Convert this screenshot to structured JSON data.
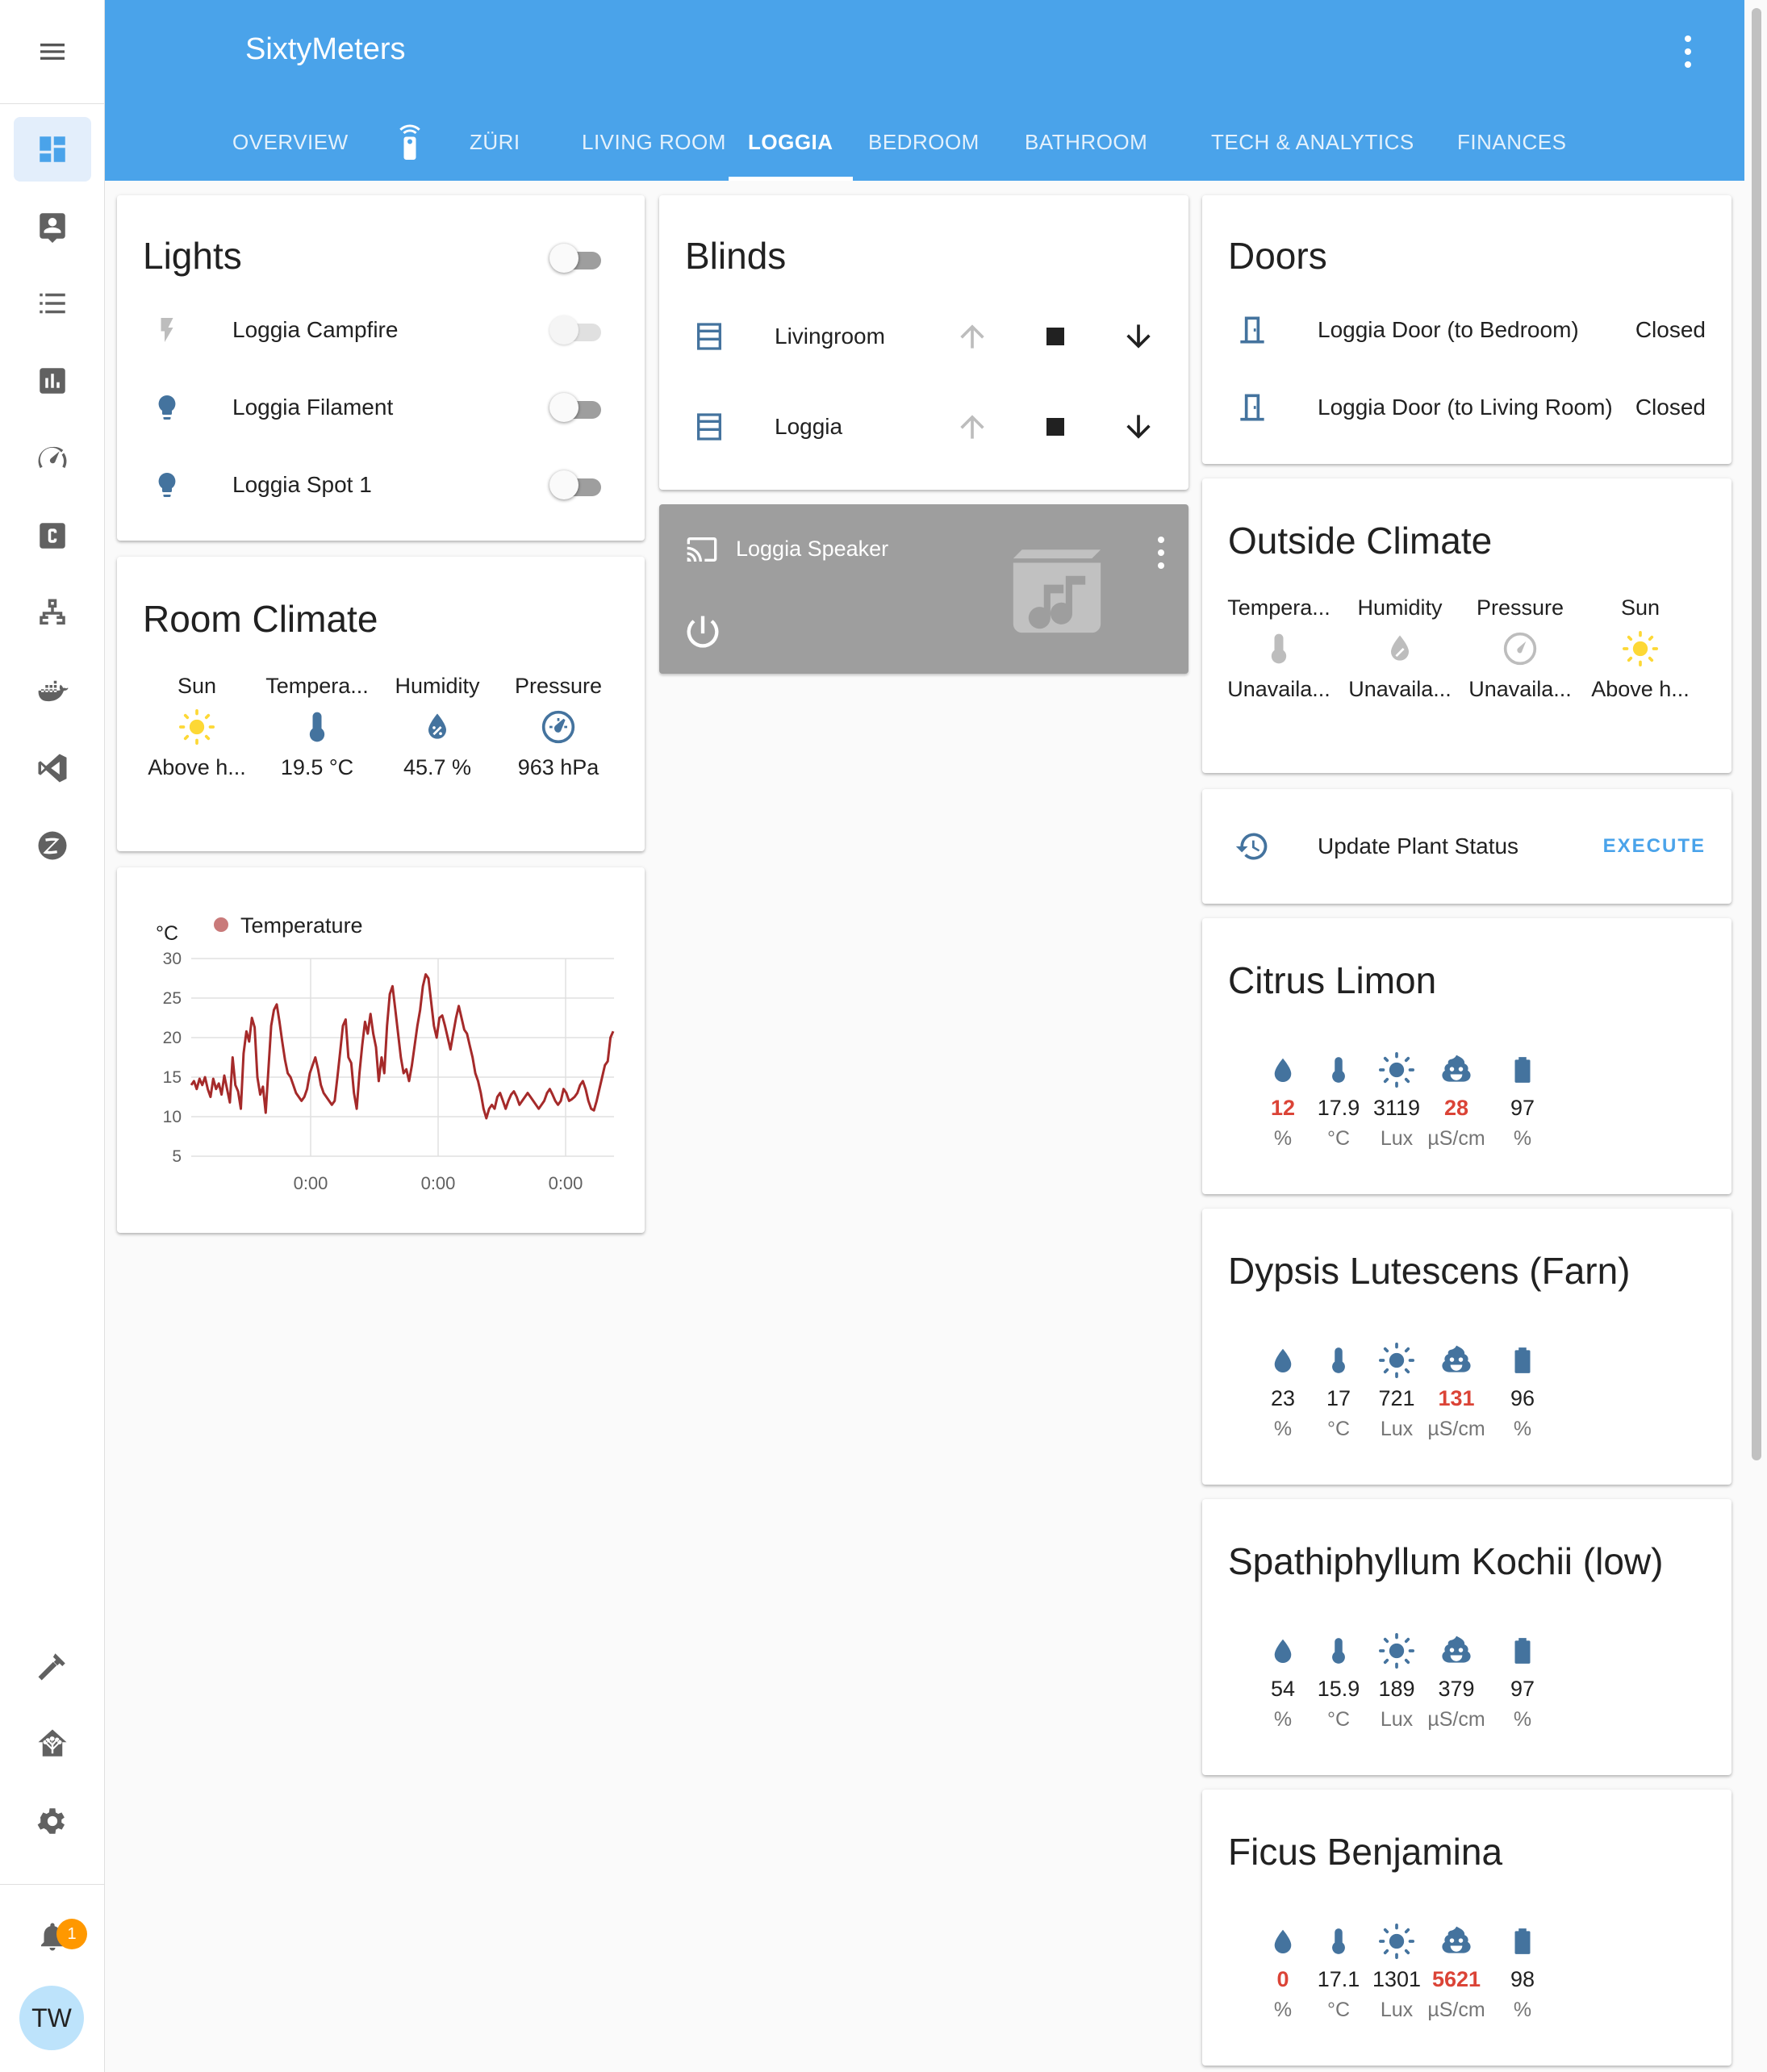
{
  "app": {
    "title": "SixtyMeters"
  },
  "tabs": [
    {
      "label": "OVERVIEW"
    },
    {
      "label": "ZÜRI"
    },
    {
      "label": "LIVING ROOM"
    },
    {
      "label": "LOGGIA"
    },
    {
      "label": "BEDROOM"
    },
    {
      "label": "BATHROOM"
    },
    {
      "label": "TECH & ANALYTICS"
    },
    {
      "label": "FINANCES"
    }
  ],
  "sidebar": {
    "notification_count": "1",
    "user_initials": "TW"
  },
  "lights": {
    "title": "Lights",
    "items": [
      {
        "name": "Loggia Campfire"
      },
      {
        "name": "Loggia Filament"
      },
      {
        "name": "Loggia Spot 1"
      }
    ]
  },
  "blinds": {
    "title": "Blinds",
    "items": [
      {
        "name": "Livingroom"
      },
      {
        "name": "Loggia"
      }
    ]
  },
  "doors": {
    "title": "Doors",
    "items": [
      {
        "name": "Loggia Door (to Bedroom)",
        "state": "Closed"
      },
      {
        "name": "Loggia Door (to Living Room)",
        "state": "Closed"
      }
    ]
  },
  "speaker": {
    "name": "Loggia Speaker"
  },
  "room_climate": {
    "title": "Room Climate",
    "items": [
      {
        "name": "Sun",
        "value": "Above h..."
      },
      {
        "name": "Tempera...",
        "value": "19.5 °C"
      },
      {
        "name": "Humidity",
        "value": "45.7 %"
      },
      {
        "name": "Pressure",
        "value": "963 hPa"
      }
    ]
  },
  "outside_climate": {
    "title": "Outside Climate",
    "items": [
      {
        "name": "Tempera...",
        "value": "Unavaila..."
      },
      {
        "name": "Humidity",
        "value": "Unavaila..."
      },
      {
        "name": "Pressure",
        "value": "Unavaila..."
      },
      {
        "name": "Sun",
        "value": "Above h..."
      }
    ]
  },
  "script": {
    "name": "Update Plant Status",
    "action": "EXECUTE"
  },
  "plants": [
    {
      "name": "Citrus Limon",
      "moisture": "12",
      "moisture_bad": true,
      "temp": "17.9",
      "light": "3119",
      "conductivity": "28",
      "conductivity_bad": true,
      "battery": "97"
    },
    {
      "name": "Dypsis Lutescens (Farn)",
      "moisture": "23",
      "moisture_bad": false,
      "temp": "17",
      "light": "721",
      "conductivity": "131",
      "conductivity_bad": true,
      "battery": "96"
    },
    {
      "name": "Spathiphyllum Kochii (low)",
      "moisture": "54",
      "moisture_bad": false,
      "temp": "15.9",
      "light": "189",
      "conductivity": "379",
      "conductivity_bad": false,
      "battery": "97"
    },
    {
      "name": "Ficus Benjamina",
      "moisture": "0",
      "moisture_bad": true,
      "temp": "17.1",
      "light": "1301",
      "conductivity": "5621",
      "conductivity_bad": true,
      "battery": "98"
    }
  ],
  "plant_units": {
    "moisture": "%",
    "temp": "°C",
    "light": "Lux",
    "conductivity": "µS/cm",
    "battery": "%"
  },
  "colors": {
    "header": "#4aa3ea",
    "icon": "#44739e",
    "warning": "#db4437",
    "sun": "#fdd835",
    "series": "#a52a2a"
  },
  "chart_data": {
    "type": "line",
    "ylabel": "°C",
    "ylim": [
      5,
      30
    ],
    "yticks": [
      30,
      25,
      20,
      15,
      10,
      5
    ],
    "xtick_labels": [
      "0:00",
      "0:00",
      "0:00"
    ],
    "series": [
      {
        "name": "Temperature",
        "values": [
          14,
          14.5,
          13.5,
          14.8,
          14,
          15,
          13.5,
          12.5,
          14.8,
          13.5,
          14.2,
          12.8,
          15.2,
          13.5,
          11.8,
          17.5,
          14,
          13.2,
          11,
          18,
          20.8,
          19.5,
          22.5,
          21.3,
          15,
          12.8,
          13.8,
          10.5,
          16,
          21.5,
          23.5,
          24.2,
          22,
          19.5,
          17.2,
          15.5,
          15,
          14,
          13,
          12.5,
          12,
          12.5,
          13.5,
          15.5,
          16.5,
          17.5,
          16,
          14,
          13,
          12.5,
          12,
          11.5,
          12,
          15,
          18.2,
          21.5,
          22.3,
          17.5,
          16.8,
          13,
          11,
          15.5,
          19,
          22,
          20.5,
          23,
          20.5,
          18.8,
          14.5,
          17.5,
          15.5,
          21.5,
          25.5,
          26.5,
          23.5,
          20.5,
          17.5,
          15.5,
          16,
          14.5,
          16.5,
          19,
          21.5,
          23.5,
          26.5,
          28,
          27.5,
          24.5,
          21.5,
          20,
          22.5,
          22.8,
          21.5,
          20,
          18.5,
          20.5,
          22.5,
          24,
          22.5,
          21,
          20.5,
          19,
          17.5,
          15.5,
          14.5,
          13,
          11,
          9.8,
          11,
          11.5,
          11,
          12.5,
          13,
          12,
          11,
          12,
          12.8,
          13.2,
          12.5,
          11.5,
          12,
          12.5,
          13,
          12.5,
          12,
          11.5,
          11,
          11.5,
          12,
          13,
          13.5,
          12.8,
          12,
          11.5,
          12,
          13.5,
          13,
          12,
          12.2,
          12.5,
          13,
          14,
          14.5,
          13.5,
          12,
          11,
          10.8,
          12,
          13.5,
          15,
          16.5,
          17,
          20,
          20.8
        ]
      }
    ]
  }
}
